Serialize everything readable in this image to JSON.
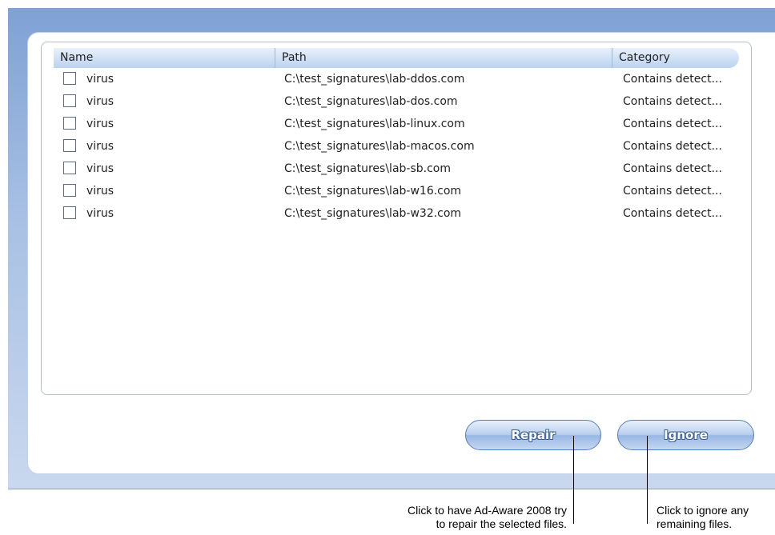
{
  "list": {
    "columns": {
      "name": "Name",
      "path": "Path",
      "category": "Category"
    },
    "rows": [
      {
        "name": "virus",
        "path": "C:\\test_signatures\\lab-ddos.com",
        "category": "Contains detect...",
        "checked": false
      },
      {
        "name": "virus",
        "path": "C:\\test_signatures\\lab-dos.com",
        "category": "Contains detect...",
        "checked": false
      },
      {
        "name": "virus",
        "path": "C:\\test_signatures\\lab-linux.com",
        "category": "Contains detect...",
        "checked": false
      },
      {
        "name": "virus",
        "path": "C:\\test_signatures\\lab-macos.com",
        "category": "Contains detect...",
        "checked": false
      },
      {
        "name": "virus",
        "path": "C:\\test_signatures\\lab-sb.com",
        "category": "Contains detect...",
        "checked": false
      },
      {
        "name": "virus",
        "path": "C:\\test_signatures\\lab-w16.com",
        "category": "Contains detect...",
        "checked": false
      },
      {
        "name": "virus",
        "path": "C:\\test_signatures\\lab-w32.com",
        "category": "Contains detect...",
        "checked": false
      }
    ]
  },
  "buttons": {
    "repair_label": "Repair",
    "ignore_label": "Ignore"
  },
  "callouts": {
    "repair_line1": "Click to have Ad-Aware 2008 try",
    "repair_line2": "to repair the selected files.",
    "ignore_line1": "Click to ignore any",
    "ignore_line2": "remaining files."
  },
  "colors": {
    "frame_blue": "#7fa1d4",
    "button_text_outline": "#3b5f94",
    "header_bg": "#cfe0f5"
  }
}
